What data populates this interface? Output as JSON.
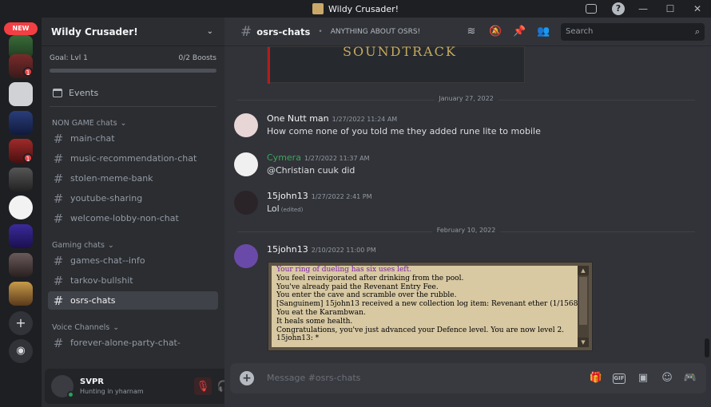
{
  "window": {
    "title": "Wildy Crusader!",
    "controls": {
      "minimize": "—",
      "maximize": "☐",
      "close": "✕"
    }
  },
  "servers": {
    "new_label": "NEW",
    "badges": [
      "1",
      "1"
    ]
  },
  "guild": {
    "name": "Wildy Crusader!",
    "goal_label": "Goal: Lvl 1",
    "boosts": "0/2 Boosts",
    "boost_progress": 0,
    "events_label": "Events"
  },
  "categories": [
    {
      "label": "NON GAME chats",
      "channels": [
        "main-chat",
        "music-recommendation-chat",
        "stolen-meme-bank",
        "youtube-sharing",
        "welcome-lobby-non-chat"
      ]
    },
    {
      "label": "Gaming chats",
      "channels": [
        "games-chat--info",
        "tarkov-bullshit",
        "osrs-chats"
      ]
    },
    {
      "label": "Voice Channels",
      "channels": [
        "forever-alone-party-chat-"
      ]
    }
  ],
  "active_channel": "osrs-chats",
  "user": {
    "name": "SVPR",
    "status": "Hunting in yharnam"
  },
  "header": {
    "channel": "osrs-chats",
    "topic": "ANYTHING ABOUT OSRS!",
    "search_placeholder": "Search"
  },
  "embed": {
    "text": "SOUNDTRACK"
  },
  "dividers": [
    "January 27, 2022",
    "February 10, 2022"
  ],
  "messages": [
    {
      "author": "One Nutt man",
      "time": "1/27/2022 11:24 AM",
      "text": "How come none of you told me they added rune lite to mobile",
      "color": "#f2f3f5"
    },
    {
      "author": "Cymera",
      "time": "1/27/2022 11:37 AM",
      "text": "@Christian cuuk did",
      "color": "#3ba55c"
    },
    {
      "author": "15john13",
      "time": "1/27/2022 2:41 PM",
      "text": "Lol",
      "edited": "(edited)",
      "color": "#f2f3f5"
    },
    {
      "author": "15john13",
      "time": "2/10/2022 11:00 PM",
      "text": "",
      "color": "#f2f3f5"
    }
  ],
  "game_chat": [
    {
      "text": "Your ring of dueling has six uses left.",
      "color": "#7a1fa2"
    },
    {
      "text": "You feel reinvigorated after drinking from the pool.",
      "color": "#000000"
    },
    {
      "text": "You've already paid the Revenant Entry Fee.",
      "color": "#000000"
    },
    {
      "text": "You enter the cave and scramble over the rubble.",
      "color": "#000000"
    },
    {
      "text": "[Sanguinem] 15john13 received a new collection log item: Revenant ether (1/1568)",
      "color": "#000000"
    },
    {
      "text": "You eat the Karambwan.",
      "color": "#000000"
    },
    {
      "text": "It heals some health.",
      "color": "#000000"
    },
    {
      "text": "Congratulations, you've just advanced your Defence level. You are now level 2.",
      "color": "#000000"
    },
    {
      "text": "15john13:  *",
      "color": "#000000"
    }
  ],
  "composer": {
    "placeholder": "Message #osrs-chats",
    "gif_label": "GIF"
  }
}
